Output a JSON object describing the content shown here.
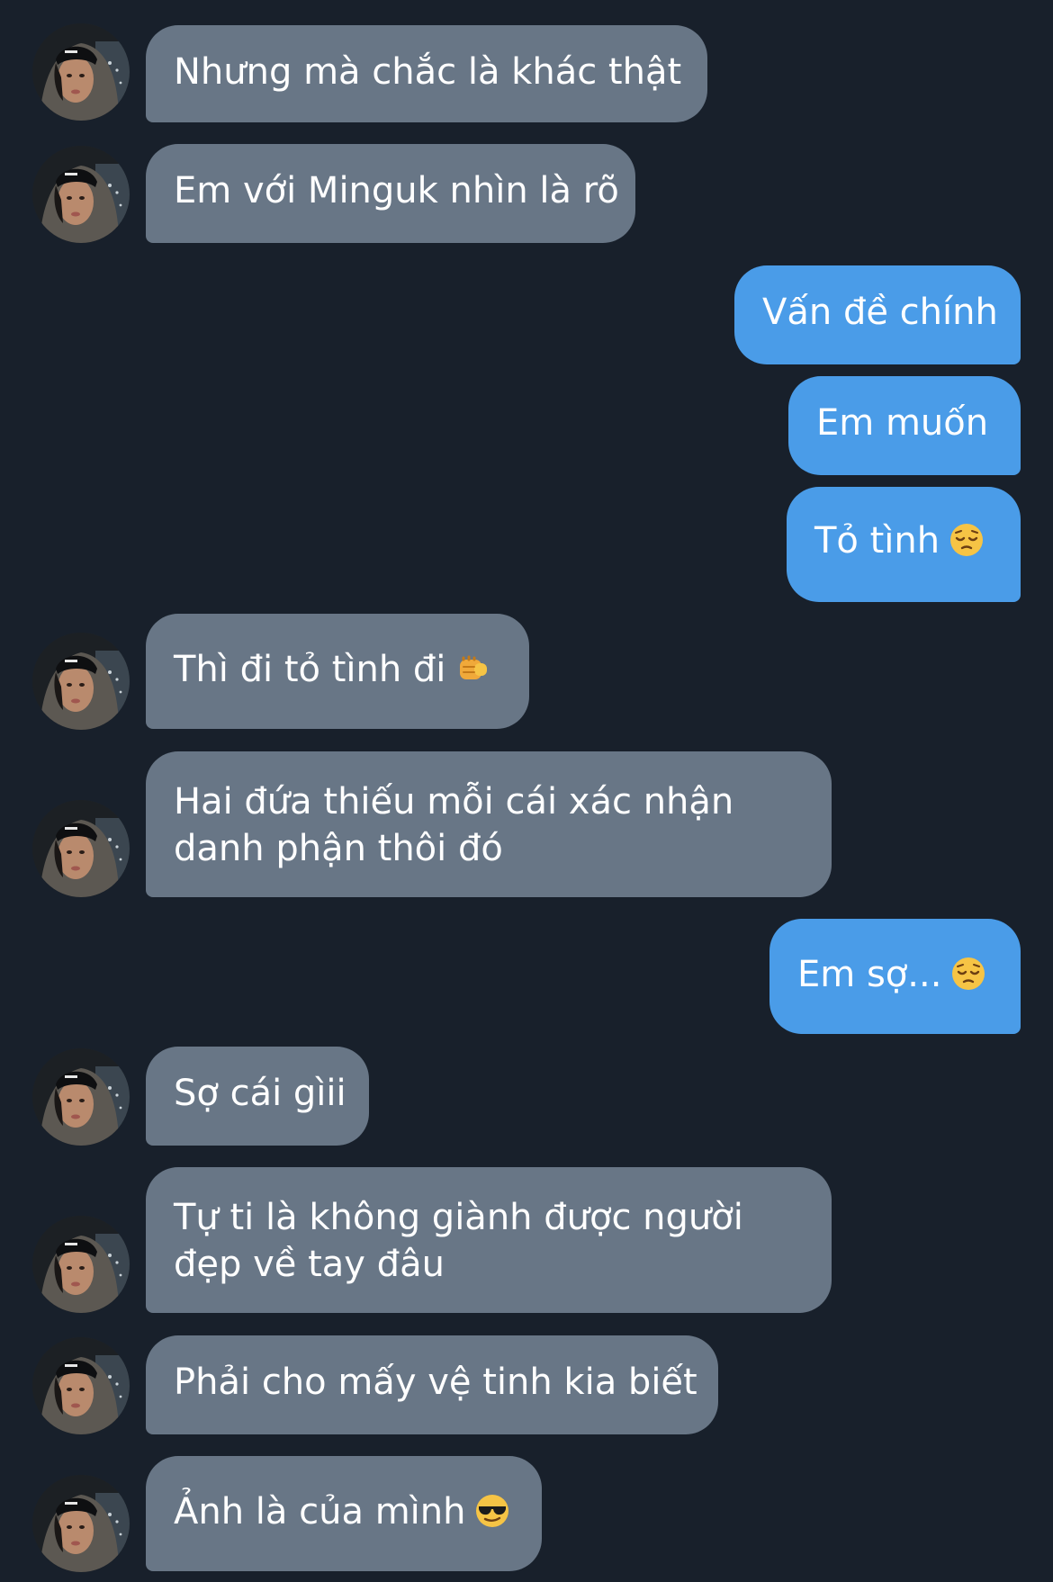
{
  "messages": [
    {
      "side": "in",
      "lines": [
        "Nhưng mà chắc là khác thật"
      ]
    },
    {
      "side": "in",
      "lines": [
        "Em với Minguk nhìn là rõ"
      ]
    },
    {
      "side": "out",
      "lines": [
        "Vấn đề chính"
      ]
    },
    {
      "side": "out",
      "lines": [
        "Em muốn"
      ]
    },
    {
      "side": "out",
      "lines": [
        "Tỏ tình"
      ],
      "emoji": "pensive-face"
    },
    {
      "side": "in",
      "lines": [
        "Thì đi tỏ tình đi"
      ],
      "emoji": "punch-fist"
    },
    {
      "side": "in",
      "lines": [
        "Hai đứa thiếu mỗi cái xác nhận",
        "danh phận thôi đó"
      ]
    },
    {
      "side": "out",
      "lines": [
        "Em sợ..."
      ],
      "emoji": "pensive-face"
    },
    {
      "side": "in",
      "lines": [
        "Sợ cái gìii"
      ]
    },
    {
      "side": "in",
      "lines": [
        "Tự ti là không giành được người",
        "đẹp về tay đâu"
      ]
    },
    {
      "side": "in",
      "lines": [
        "Phải cho mấy vệ tinh kia biết"
      ]
    },
    {
      "side": "in",
      "lines": [
        "Ảnh là của mình"
      ],
      "emoji": "sunglasses-face"
    }
  ],
  "colors": {
    "background": "#18202b",
    "incoming_bubble": "#687686",
    "outgoing_bubble": "#4a9ce8",
    "text": "#ffffff"
  }
}
